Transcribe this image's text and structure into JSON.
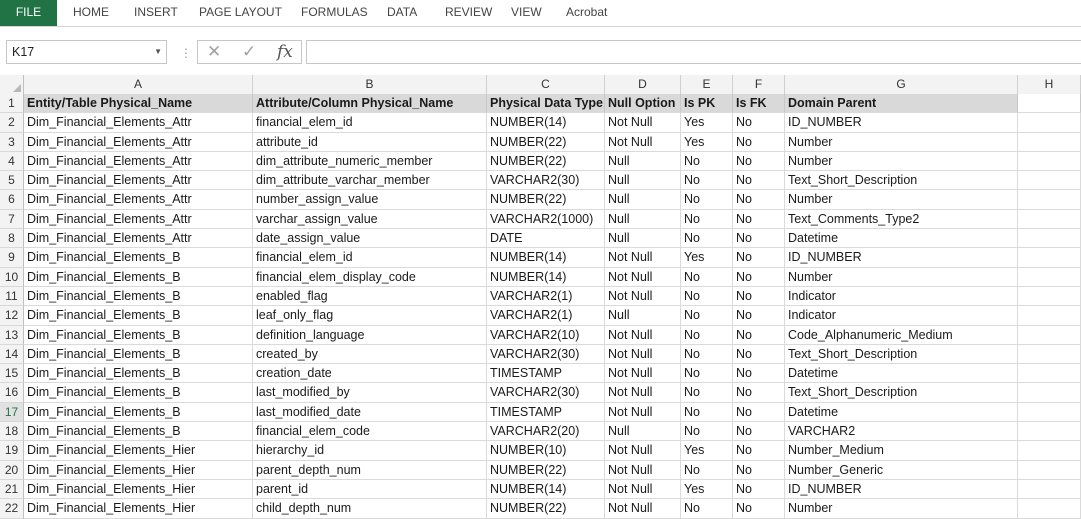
{
  "ribbon": {
    "tabs": [
      "FILE",
      "HOME",
      "INSERT",
      "PAGE LAYOUT",
      "FORMULAS",
      "DATA",
      "REVIEW",
      "VIEW",
      "Acrobat"
    ]
  },
  "formula_bar": {
    "name_box": "K17",
    "cancel_icon": "✕",
    "enter_icon": "✓",
    "fx_label": "fx",
    "formula": ""
  },
  "columns": [
    "A",
    "B",
    "C",
    "D",
    "E",
    "F",
    "G",
    "H"
  ],
  "active_row": 17,
  "header": {
    "row_number": "1",
    "cells": [
      "Entity/Table Physical_Name",
      "Attribute/Column Physical_Name",
      "Physical Data Type",
      "Null Option",
      "Is PK",
      "Is FK",
      "Domain Parent",
      ""
    ]
  },
  "rows": [
    {
      "n": "2",
      "cells": [
        "Dim_Financial_Elements_Attr",
        "financial_elem_id",
        "NUMBER(14)",
        "Not Null",
        "Yes",
        "No",
        "ID_NUMBER",
        ""
      ]
    },
    {
      "n": "3",
      "cells": [
        "Dim_Financial_Elements_Attr",
        "attribute_id",
        "NUMBER(22)",
        "Not Null",
        "Yes",
        "No",
        "Number",
        ""
      ]
    },
    {
      "n": "4",
      "cells": [
        "Dim_Financial_Elements_Attr",
        "dim_attribute_numeric_member",
        "NUMBER(22)",
        "Null",
        "No",
        "No",
        "Number",
        ""
      ]
    },
    {
      "n": "5",
      "cells": [
        "Dim_Financial_Elements_Attr",
        "dim_attribute_varchar_member",
        "VARCHAR2(30)",
        "Null",
        "No",
        "No",
        "Text_Short_Description",
        ""
      ]
    },
    {
      "n": "6",
      "cells": [
        "Dim_Financial_Elements_Attr",
        "number_assign_value",
        "NUMBER(22)",
        "Null",
        "No",
        "No",
        "Number",
        ""
      ]
    },
    {
      "n": "7",
      "cells": [
        "Dim_Financial_Elements_Attr",
        "varchar_assign_value",
        "VARCHAR2(1000)",
        "Null",
        "No",
        "No",
        "Text_Comments_Type2",
        ""
      ]
    },
    {
      "n": "8",
      "cells": [
        "Dim_Financial_Elements_Attr",
        "date_assign_value",
        "DATE",
        "Null",
        "No",
        "No",
        "Datetime",
        ""
      ]
    },
    {
      "n": "9",
      "cells": [
        "Dim_Financial_Elements_B",
        "financial_elem_id",
        "NUMBER(14)",
        "Not Null",
        "Yes",
        "No",
        "ID_NUMBER",
        ""
      ]
    },
    {
      "n": "10",
      "cells": [
        "Dim_Financial_Elements_B",
        "financial_elem_display_code",
        "NUMBER(14)",
        "Not Null",
        "No",
        "No",
        "Number",
        ""
      ]
    },
    {
      "n": "11",
      "cells": [
        "Dim_Financial_Elements_B",
        "enabled_flag",
        "VARCHAR2(1)",
        "Not Null",
        "No",
        "No",
        "Indicator",
        ""
      ]
    },
    {
      "n": "12",
      "cells": [
        "Dim_Financial_Elements_B",
        "leaf_only_flag",
        "VARCHAR2(1)",
        "Null",
        "No",
        "No",
        "Indicator",
        ""
      ]
    },
    {
      "n": "13",
      "cells": [
        "Dim_Financial_Elements_B",
        "definition_language",
        "VARCHAR2(10)",
        "Not Null",
        "No",
        "No",
        "Code_Alphanumeric_Medium",
        ""
      ]
    },
    {
      "n": "14",
      "cells": [
        "Dim_Financial_Elements_B",
        "created_by",
        "VARCHAR2(30)",
        "Not Null",
        "No",
        "No",
        "Text_Short_Description",
        ""
      ]
    },
    {
      "n": "15",
      "cells": [
        "Dim_Financial_Elements_B",
        "creation_date",
        "TIMESTAMP",
        "Not Null",
        "No",
        "No",
        "Datetime",
        ""
      ]
    },
    {
      "n": "16",
      "cells": [
        "Dim_Financial_Elements_B",
        "last_modified_by",
        "VARCHAR2(30)",
        "Not Null",
        "No",
        "No",
        "Text_Short_Description",
        ""
      ]
    },
    {
      "n": "17",
      "cells": [
        "Dim_Financial_Elements_B",
        "last_modified_date",
        "TIMESTAMP",
        "Not Null",
        "No",
        "No",
        "Datetime",
        ""
      ]
    },
    {
      "n": "18",
      "cells": [
        "Dim_Financial_Elements_B",
        "financial_elem_code",
        "VARCHAR2(20)",
        "Null",
        "No",
        "No",
        "VARCHAR2",
        ""
      ]
    },
    {
      "n": "19",
      "cells": [
        "Dim_Financial_Elements_Hier",
        "hierarchy_id",
        "NUMBER(10)",
        "Not Null",
        "Yes",
        "No",
        "Number_Medium",
        ""
      ]
    },
    {
      "n": "20",
      "cells": [
        "Dim_Financial_Elements_Hier",
        "parent_depth_num",
        "NUMBER(22)",
        "Not Null",
        "No",
        "No",
        "Number_Generic",
        ""
      ]
    },
    {
      "n": "21",
      "cells": [
        "Dim_Financial_Elements_Hier",
        "parent_id",
        "NUMBER(14)",
        "Not Null",
        "Yes",
        "No",
        "ID_NUMBER",
        ""
      ]
    },
    {
      "n": "22",
      "cells": [
        "Dim_Financial_Elements_Hier",
        "child_depth_num",
        "NUMBER(22)",
        "Not Null",
        "No",
        "No",
        "Number",
        ""
      ]
    }
  ]
}
